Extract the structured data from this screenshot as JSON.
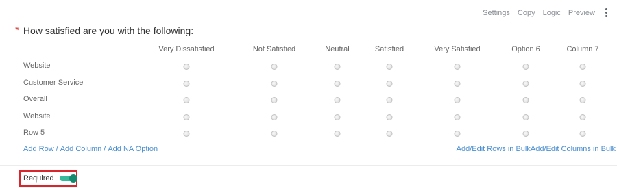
{
  "toolbar": {
    "settings": "Settings",
    "copy": "Copy",
    "logic": "Logic",
    "preview": "Preview"
  },
  "question": {
    "required_marker": "*",
    "text": "How satisfied are you with the following:"
  },
  "matrix": {
    "columns": [
      "Very Dissatisfied",
      "Not Satisfied",
      "Neutral",
      "Satisfied",
      "Very Satisfied",
      "Option 6",
      "Column 7"
    ],
    "rows": [
      "Website",
      "Customer Service",
      "Overall",
      "Website",
      "Row 5"
    ]
  },
  "links": {
    "add_row": "Add Row",
    "add_column": "Add Column",
    "add_na": "Add NA Option",
    "separator": "/",
    "bulk_rows": "Add/Edit Rows in Bulk",
    "bulk_columns": "Add/Edit Columns in Bulk"
  },
  "required": {
    "label": "Required",
    "enabled": true
  },
  "colors": {
    "accent_link": "#4a8fd1",
    "toggle_on": "#39b99b",
    "highlight_border": "#d9262c",
    "required_star": "#d9423b"
  }
}
